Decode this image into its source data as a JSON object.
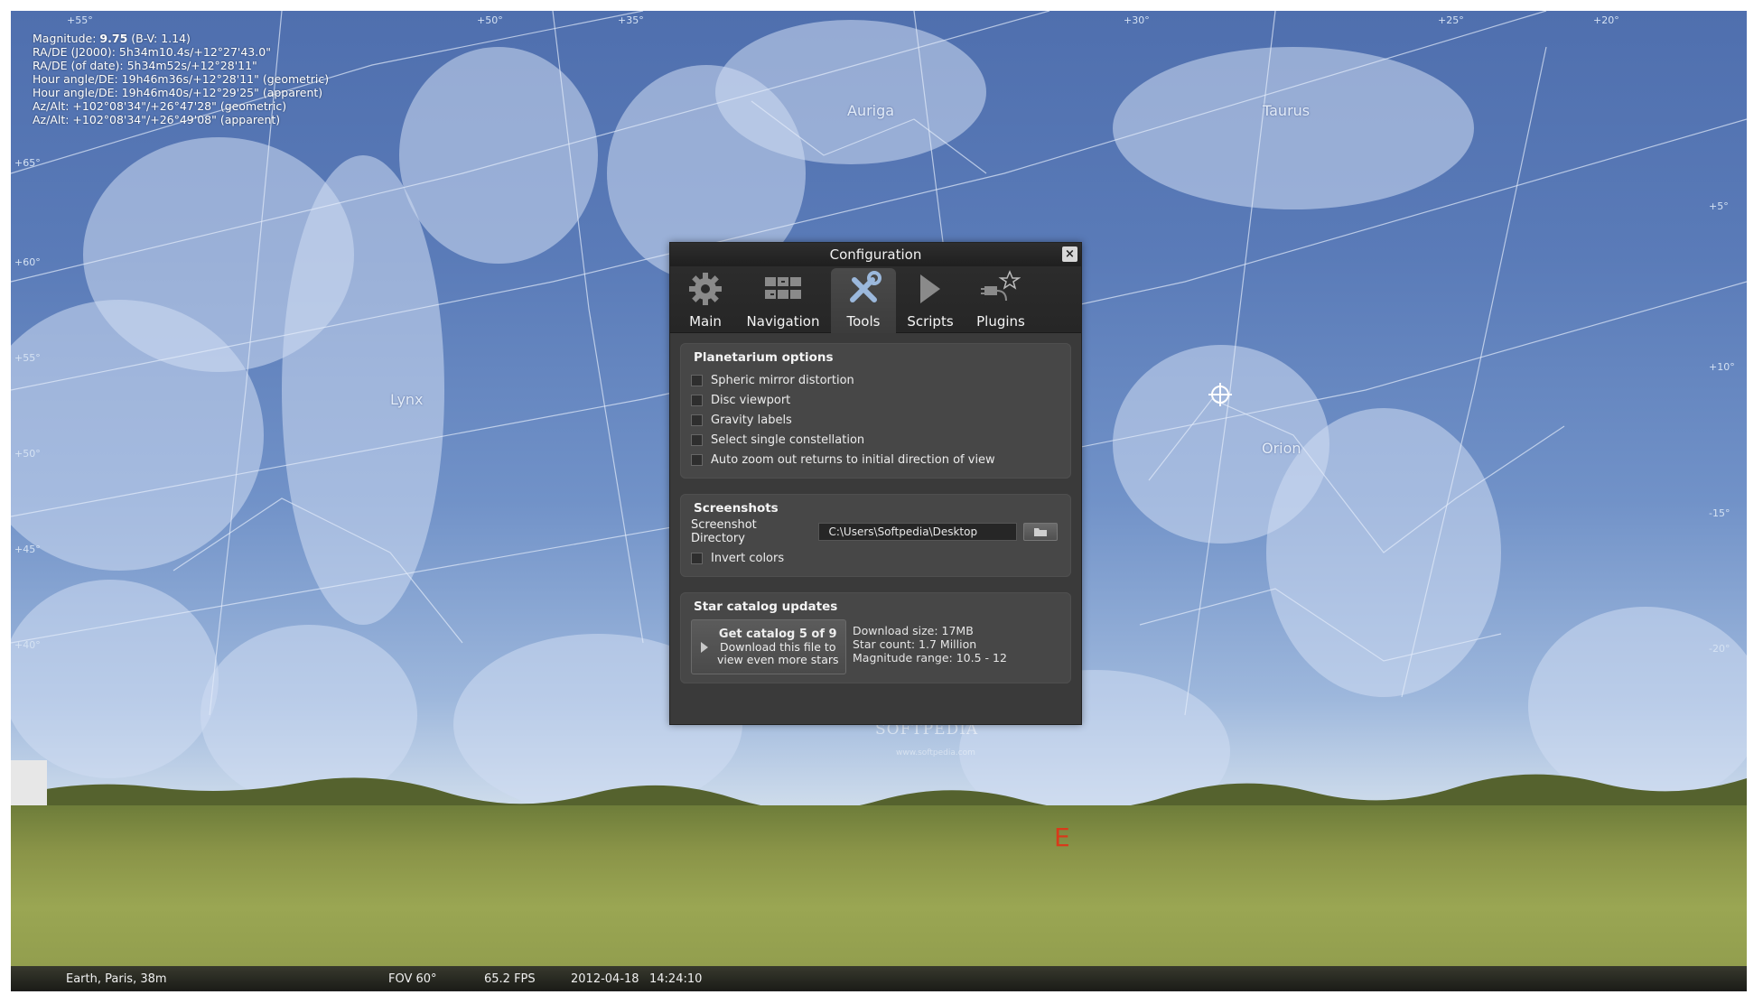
{
  "info": {
    "magnitude_label": "Magnitude:",
    "magnitude_value": "9.75",
    "bv": "(B-V: 1.14)",
    "lines": [
      "RA/DE (J2000): 5h34m10.4s/+12°27'43.0\"",
      "RA/DE (of date): 5h34m52s/+12°28'11\"",
      "Hour angle/DE: 19h46m36s/+12°28'11\" (geometric)",
      "Hour angle/DE: 19h46m40s/+12°29'25\" (apparent)",
      "Az/Alt: +102°08'34\"/+26°47'28\" (geometric)",
      "Az/Alt: +102°08'34\"/+26°49'08\" (apparent)"
    ]
  },
  "constellations": [
    "Auriga",
    "Taurus",
    "Lynx",
    "Orion"
  ],
  "grid_labels": [
    "+65°",
    "+60°",
    "+55°",
    "+50°",
    "+45°",
    "+40°",
    "+55°",
    "+50°",
    "+35°",
    "+30°",
    "+25°",
    "+20°",
    "+10°",
    "+5°",
    "-15°",
    "-20°"
  ],
  "compass": "E",
  "dialog": {
    "title": "Configuration",
    "close": "×",
    "tabs": [
      {
        "label": "Main",
        "icon": "gear-icon"
      },
      {
        "label": "Navigation",
        "icon": "navigation-icon"
      },
      {
        "label": "Tools",
        "icon": "tools-icon"
      },
      {
        "label": "Scripts",
        "icon": "play-icon"
      },
      {
        "label": "Plugins",
        "icon": "plugin-icon"
      }
    ],
    "active_tab": "Tools",
    "planetarium": {
      "title": "Planetarium options",
      "options": [
        "Spheric mirror distortion",
        "Disc viewport",
        "Gravity labels",
        "Select single constellation",
        "Auto zoom out returns to initial direction of view"
      ]
    },
    "screenshots": {
      "title": "Screenshots",
      "dir_label": "Screenshot Directory",
      "dir_value": "C:\\Users\\Softpedia\\Desktop",
      "invert_label": "Invert colors"
    },
    "catalog": {
      "title": "Star catalog updates",
      "button_line1": "Get catalog 5 of 9",
      "button_line2": "Download this file to",
      "button_line3": "view even more stars",
      "download_size": "Download size: 17MB",
      "star_count": "Star count: 1.7 Million",
      "magnitude_range": "Magnitude range: 10.5 - 12"
    }
  },
  "watermark": "SOFTPEDIA",
  "watermark_sub": "www.softpedia.com",
  "status": {
    "location": "Earth, Paris, 38m",
    "fov": "FOV 60°",
    "fps": "65.2 FPS",
    "date": "2012-04-18",
    "time": "14:24:10"
  },
  "colors": {
    "sky_top": "#4f6fae",
    "sky_horizon": "#c9d8ea",
    "dialog_bg": "#3a3a3a",
    "compass": "#d83a1a"
  }
}
